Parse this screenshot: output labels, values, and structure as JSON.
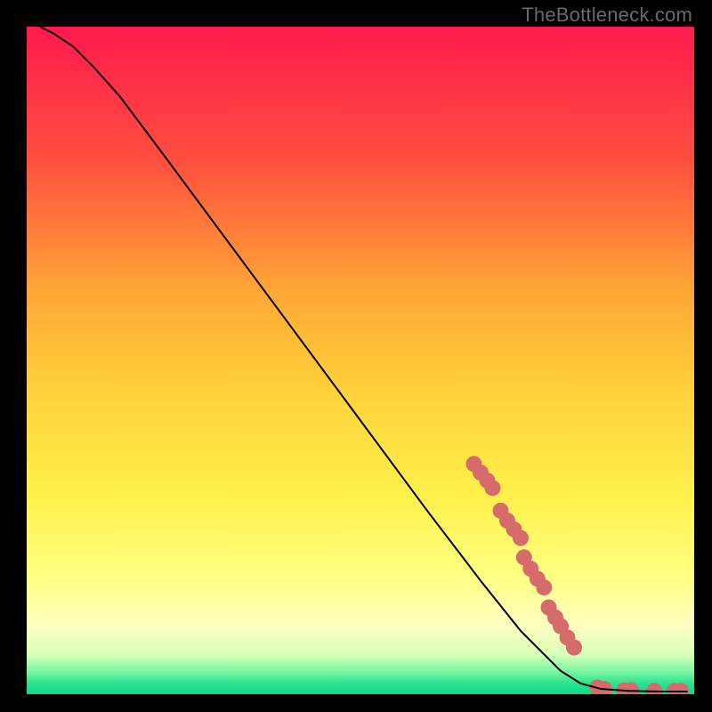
{
  "watermark": "TheBottleneck.com",
  "chart_data": {
    "type": "line",
    "title": "",
    "xlabel": "",
    "ylabel": "",
    "xlim": [
      0,
      100
    ],
    "ylim": [
      0,
      100
    ],
    "background_gradient": {
      "stops": [
        {
          "offset": 0.0,
          "color": "#ff1a4d"
        },
        {
          "offset": 0.2,
          "color": "#ff4f3e"
        },
        {
          "offset": 0.4,
          "color": "#ffa836"
        },
        {
          "offset": 0.55,
          "color": "#ffd23a"
        },
        {
          "offset": 0.7,
          "color": "#fff04a"
        },
        {
          "offset": 0.82,
          "color": "#ffff80"
        },
        {
          "offset": 0.9,
          "color": "#fdffc1"
        },
        {
          "offset": 0.94,
          "color": "#d8ffb8"
        },
        {
          "offset": 0.965,
          "color": "#7ef7a3"
        },
        {
          "offset": 0.985,
          "color": "#27e28f"
        },
        {
          "offset": 1.0,
          "color": "#0fd98a"
        }
      ]
    },
    "series": [
      {
        "name": "curve",
        "stroke": "#000000",
        "stroke_width": 2,
        "points": [
          {
            "x": 2.0,
            "y": 100.0
          },
          {
            "x": 4.0,
            "y": 99.0
          },
          {
            "x": 7.0,
            "y": 97.0
          },
          {
            "x": 10.0,
            "y": 94.0
          },
          {
            "x": 14.0,
            "y": 89.5
          },
          {
            "x": 20.0,
            "y": 81.5
          },
          {
            "x": 30.0,
            "y": 68.0
          },
          {
            "x": 40.0,
            "y": 54.5
          },
          {
            "x": 50.0,
            "y": 41.0
          },
          {
            "x": 60.0,
            "y": 27.5
          },
          {
            "x": 68.0,
            "y": 17.0
          },
          {
            "x": 74.0,
            "y": 9.5
          },
          {
            "x": 80.0,
            "y": 3.5
          },
          {
            "x": 83.0,
            "y": 1.6
          },
          {
            "x": 86.0,
            "y": 0.8
          },
          {
            "x": 90.0,
            "y": 0.5
          },
          {
            "x": 95.0,
            "y": 0.4
          },
          {
            "x": 99.0,
            "y": 0.4
          }
        ]
      },
      {
        "name": "markers",
        "marker_color": "#d66b6b",
        "marker_radius": 9,
        "points": [
          {
            "x": 67.0,
            "y": 34.5
          },
          {
            "x": 68.0,
            "y": 33.2
          },
          {
            "x": 69.0,
            "y": 32.0
          },
          {
            "x": 69.8,
            "y": 30.9
          },
          {
            "x": 71.0,
            "y": 27.5
          },
          {
            "x": 72.0,
            "y": 26.0
          },
          {
            "x": 73.0,
            "y": 24.7
          },
          {
            "x": 74.0,
            "y": 23.4
          },
          {
            "x": 74.5,
            "y": 20.5
          },
          {
            "x": 75.5,
            "y": 18.8
          },
          {
            "x": 76.5,
            "y": 17.3
          },
          {
            "x": 77.5,
            "y": 16.0
          },
          {
            "x": 78.2,
            "y": 13.0
          },
          {
            "x": 79.2,
            "y": 11.5
          },
          {
            "x": 80.0,
            "y": 10.2
          },
          {
            "x": 81.0,
            "y": 8.5
          },
          {
            "x": 82.0,
            "y": 7.0
          },
          {
            "x": 85.5,
            "y": 1.0
          },
          {
            "x": 86.5,
            "y": 0.8
          },
          {
            "x": 89.5,
            "y": 0.6
          },
          {
            "x": 90.5,
            "y": 0.6
          },
          {
            "x": 94.0,
            "y": 0.5
          },
          {
            "x": 97.0,
            "y": 0.5
          },
          {
            "x": 98.0,
            "y": 0.5
          }
        ]
      }
    ]
  }
}
